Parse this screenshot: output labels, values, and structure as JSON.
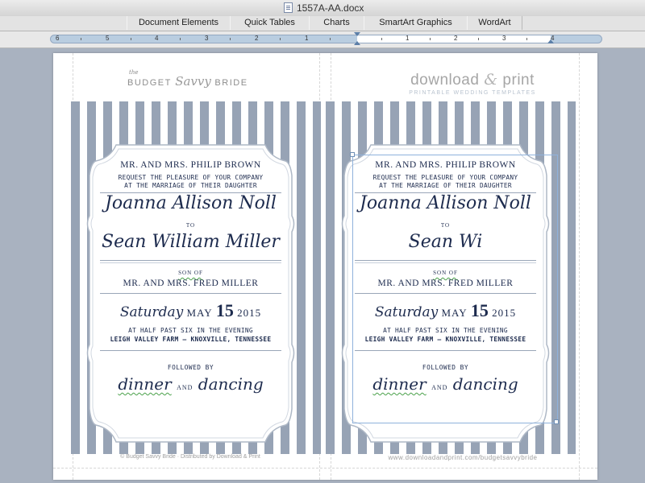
{
  "window": {
    "title": "1557A-AA.docx"
  },
  "ribbon": {
    "tabs": [
      {
        "label": "Document Elements"
      },
      {
        "label": "Quick Tables"
      },
      {
        "label": "Charts"
      },
      {
        "label": "SmartArt Graphics"
      },
      {
        "label": "WordArt"
      }
    ]
  },
  "ruler": {
    "numbers": [
      "6",
      "5",
      "4",
      "3",
      "2",
      "1",
      "1",
      "2",
      "3",
      "4"
    ]
  },
  "branding": {
    "left_logo_small": "the",
    "left_logo_a": "BUDGET",
    "left_logo_script": "Savvy",
    "left_logo_b": "BRIDE",
    "right_logo_a": "download",
    "right_logo_amp": "&",
    "right_logo_b": "print",
    "right_logo_sub": "PRINTABLE WEDDING TEMPLATES"
  },
  "left_card": {
    "hosts": "MR. AND MRS. PHILIP BROWN",
    "request_1": "REQUEST THE PLEASURE OF YOUR COMPANY",
    "request_2": "AT THE MARRIAGE OF THEIR DAUGHTER",
    "bride": "Joanna Allison Noll",
    "to": "TO",
    "groom": "Sean William Miller",
    "son_of": "SON OF",
    "groom_parents": "MR. AND MRS. FRED MILLER",
    "day": "Saturday",
    "month": "MAY",
    "date_num": "15",
    "year": "2015",
    "time": "AT HALF PAST SIX IN THE EVENING",
    "venue": "LEIGH VALLEY FARM – KNOXVILLE, TENNESSEE",
    "followed": "FOLLOWED BY",
    "dinner": "dinner",
    "and": "AND",
    "dancing": "dancing"
  },
  "right_card": {
    "hosts": "MR. AND MRS. PHILIP BROWN",
    "request_1": "REQUEST THE PLEASURE OF YOUR COMPANY",
    "request_2": "AT THE MARRIAGE OF THEIR DAUGHTER",
    "bride": "Joanna Allison Noll",
    "to": "TO",
    "groom": "Sean Wi",
    "son_of": "SON OF",
    "groom_parents": "MR. AND MRS. FRED MILLER",
    "day": "Saturday",
    "month": "MAY",
    "date_num": "15",
    "year": "2015",
    "time": "AT HALF PAST SIX IN THE EVENING",
    "venue": "LEIGH VALLEY FARM – KNOXVILLE, TENNESSEE",
    "followed": "FOLLOWED BY",
    "dinner": "dinner",
    "and": "AND",
    "dancing": "dancing"
  },
  "footer": {
    "left": "© Budget Savvy Bride · Distributed by Download & Print",
    "right": "www.downloadandprint.com/budgetsavvybride"
  },
  "colors": {
    "stripe": "#97a3b5",
    "ink": "#1d2b4e",
    "ruler": "#b9cde0",
    "selection": "#8fb2dc"
  }
}
